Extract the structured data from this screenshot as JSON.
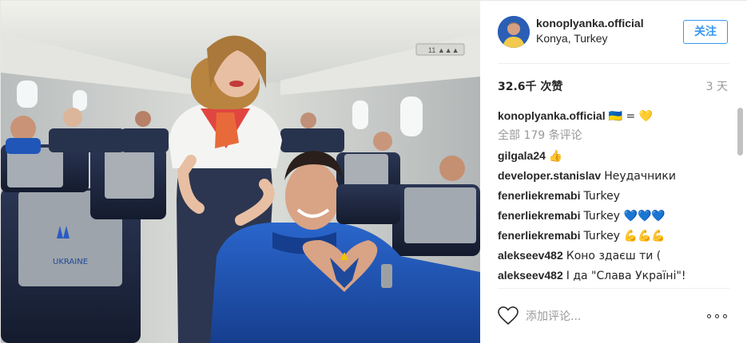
{
  "header": {
    "username": "konoplyanka.official",
    "location": "Konya, Turkey",
    "follow_label": "关注"
  },
  "stats": {
    "likes": "32.6千 次赞",
    "time": "3 天"
  },
  "caption": {
    "username": "konoplyanka.official",
    "text": "🇺🇦 = 💛"
  },
  "view_all": "全部 179 条评论",
  "comments": [
    {
      "user": "gilgala24",
      "text": "👍"
    },
    {
      "user": "developer.stanislav",
      "text": "Неудачники"
    },
    {
      "user": "fenerliekremabi",
      "text": "Turkey"
    },
    {
      "user": "fenerliekremabi",
      "text": "Turkey 💙💙💙"
    },
    {
      "user": "fenerliekremabi",
      "text": "Turkey 💪💪💪"
    },
    {
      "user": "alekseev482",
      "text": "Коно здаєш ти ("
    },
    {
      "user": "alekseev482",
      "text": "І да \"Слава Україні\"!"
    }
  ],
  "footer": {
    "add_comment_placeholder": "添加评论..."
  },
  "colors": {
    "link_blue": "#3897f0",
    "muted_gray": "#999999",
    "jersey_blue": "#1f56b8",
    "scarf_red": "#e0463f"
  },
  "icons": {
    "like": "heart-icon",
    "more": "more-options-icon"
  }
}
